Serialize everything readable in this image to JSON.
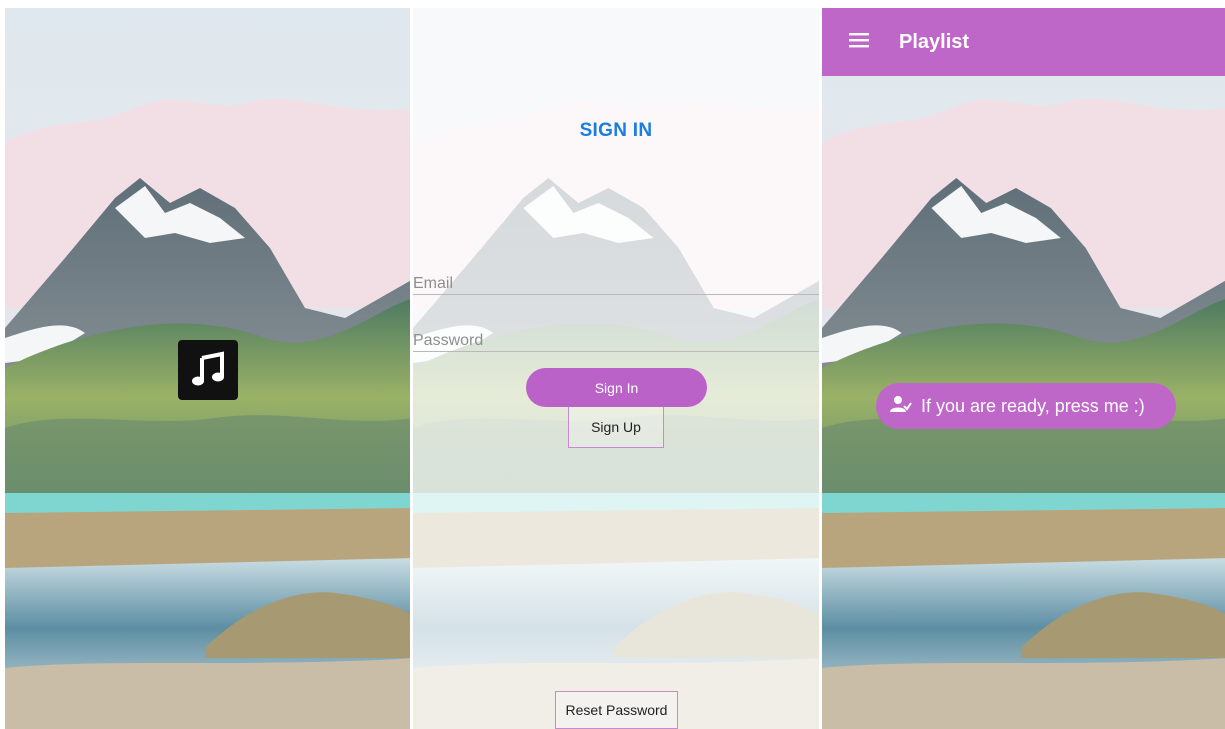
{
  "splash": {
    "icon": "music-note-icon"
  },
  "signin": {
    "title": "SIGN IN",
    "email_placeholder": "Email",
    "password_placeholder": "Password",
    "signin_label": "Sign In",
    "signup_label": "Sign Up",
    "reset_label": "Reset Password"
  },
  "playlist": {
    "menu_icon": "menu-icon",
    "title": "Playlist",
    "ready_button": {
      "icon": "person-check-icon",
      "label": "If you are ready, press me :)"
    }
  },
  "colors": {
    "accent": "#bf66c9",
    "title_blue": "#1a7de0",
    "lake": "#7fd6d0"
  }
}
